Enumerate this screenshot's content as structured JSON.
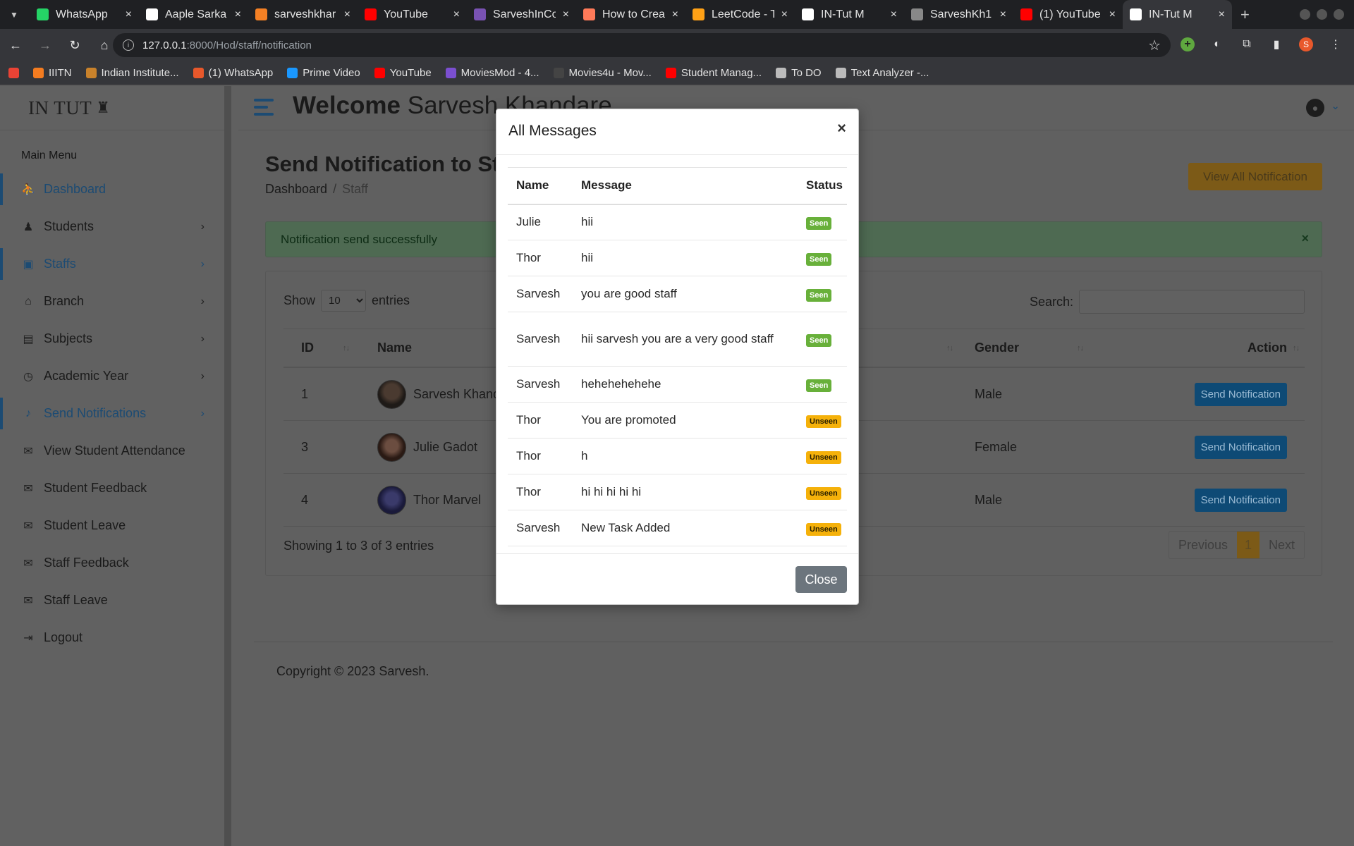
{
  "browser": {
    "tabs": [
      {
        "title": "WhatsApp",
        "icon": "whatsapp-icon",
        "color": "#25d366"
      },
      {
        "title": "Aaple Sarka",
        "icon": "doc-icon",
        "color": "#ffffff"
      },
      {
        "title": "sarveshkhar",
        "icon": "stackoverflow-icon",
        "color": "#f48024"
      },
      {
        "title": "YouTube",
        "icon": "youtube-icon",
        "color": "#ff0000"
      },
      {
        "title": "SarveshInCo",
        "icon": "bootstrap-icon",
        "color": "#7952b3"
      },
      {
        "title": "How to Crea",
        "icon": "hubspot-icon",
        "color": "#ff7a59"
      },
      {
        "title": "LeetCode - T",
        "icon": "leetcode-icon",
        "color": "#ffa116"
      },
      {
        "title": "IN-Tut M",
        "icon": "intut-icon",
        "color": "#ffffff"
      },
      {
        "title": "SarveshKh1",
        "icon": "github-icon",
        "color": "#888888"
      },
      {
        "title": "(1) YouTube",
        "icon": "youtube-icon",
        "color": "#ff0000"
      },
      {
        "title": "IN-Tut M",
        "icon": "intut-icon",
        "color": "#ffffff",
        "active": true
      }
    ],
    "url_host": "127.0.0.1",
    "url_path": ":8000/Hod/staff/notification",
    "bookmarks": [
      {
        "label": "",
        "icon": "gmail-icon",
        "color": "#ea4335"
      },
      {
        "label": "IIITN",
        "icon": "iiitn-icon",
        "color": "#f47c20"
      },
      {
        "label": "Indian Institute...",
        "icon": "institute-icon",
        "color": "#c9822b"
      },
      {
        "label": "(1) WhatsApp",
        "icon": "whatsapp-alert-icon",
        "color": "#e8582b"
      },
      {
        "label": "Prime Video",
        "icon": "prime-video-icon",
        "color": "#1a98ff"
      },
      {
        "label": "YouTube",
        "icon": "youtube-icon",
        "color": "#ff0000"
      },
      {
        "label": "MoviesMod - 4...",
        "icon": "moviesmod-icon",
        "color": "#7b4fd0"
      },
      {
        "label": "Movies4u - Mov...",
        "icon": "movies4u-icon",
        "color": "#444444"
      },
      {
        "label": "Student Manag...",
        "icon": "youtube-icon",
        "color": "#ff0000"
      },
      {
        "label": "To DO",
        "icon": "globe-icon",
        "color": "#bbbbbb"
      },
      {
        "label": "Text Analyzer -...",
        "icon": "gear-icon",
        "color": "#bbbbbb"
      }
    ]
  },
  "app": {
    "logo": "IN TUT",
    "menu_title": "Main Menu",
    "menu": [
      {
        "label": "Dashboard",
        "icon": "dashboard-icon",
        "active": true,
        "chevron": false
      },
      {
        "label": "Students",
        "icon": "students-icon",
        "active": false,
        "chevron": true
      },
      {
        "label": "Staffs",
        "icon": "staffs-icon",
        "active": true,
        "chevron": true
      },
      {
        "label": "Branch",
        "icon": "branch-icon",
        "active": false,
        "chevron": true
      },
      {
        "label": "Subjects",
        "icon": "subjects-icon",
        "active": false,
        "chevron": true
      },
      {
        "label": "Academic Year",
        "icon": "clock-icon",
        "active": false,
        "chevron": true
      },
      {
        "label": "Send Notifications",
        "icon": "bell-icon",
        "active": true,
        "chevron": true
      },
      {
        "label": "View Student Attendance",
        "icon": "chat-icon",
        "active": false,
        "chevron": false
      },
      {
        "label": "Student Feedback",
        "icon": "chat-icon",
        "active": false,
        "chevron": false
      },
      {
        "label": "Student Leave",
        "icon": "chat-icon",
        "active": false,
        "chevron": false
      },
      {
        "label": "Staff Feedback",
        "icon": "chat-icon",
        "active": false,
        "chevron": false
      },
      {
        "label": "Staff Leave",
        "icon": "chat-icon",
        "active": false,
        "chevron": false
      },
      {
        "label": "Logout",
        "icon": "logout-icon",
        "active": false,
        "chevron": false
      }
    ],
    "welcome_bold": "Welcome",
    "welcome_name": "Sarvesh Khandare",
    "page_title": "Send Notification to St",
    "breadcrumb": {
      "home": "Dashboard",
      "current": "Staff"
    },
    "view_all_label": "View All Notification",
    "alert_text": "Notification send successfully",
    "show_label": "Show",
    "entries_value": "10",
    "entries_label": "entries",
    "search_label": "Search:",
    "table": {
      "headers": {
        "id": "ID",
        "name": "Name",
        "gender": "Gender",
        "action": "Action"
      },
      "rows": [
        {
          "id": "1",
          "name": "Sarvesh Khand",
          "gender": "Male",
          "action": "Send Notification"
        },
        {
          "id": "3",
          "name": "Julie Gadot",
          "gender": "Female",
          "action": "Send Notification"
        },
        {
          "id": "4",
          "name": "Thor Marvel",
          "gender": "Male",
          "action": "Send Notification"
        }
      ]
    },
    "showing_text": "Showing 1 to 3 of 3 entries",
    "pager": {
      "previous": "Previous",
      "page": "1",
      "next": "Next"
    },
    "copyright": "Copyright © 2023 Sarvesh."
  },
  "modal": {
    "title": "All Messages",
    "close_x": "×",
    "headers": {
      "name": "Name",
      "message": "Message",
      "status": "Status"
    },
    "messages": [
      {
        "name": "Julie",
        "message": "hii",
        "status": "Seen"
      },
      {
        "name": "Thor",
        "message": "hii",
        "status": "Seen"
      },
      {
        "name": "Sarvesh",
        "message": "you are good staff",
        "status": "Seen"
      },
      {
        "name": "Sarvesh",
        "message": "hii sarvesh you are a very good staff",
        "status": "Seen"
      },
      {
        "name": "Sarvesh",
        "message": "hehehehehehe",
        "status": "Seen"
      },
      {
        "name": "Thor",
        "message": "You are promoted",
        "status": "Unseen"
      },
      {
        "name": "Thor",
        "message": "h",
        "status": "Unseen"
      },
      {
        "name": "Thor",
        "message": "hi hi hi hi hi",
        "status": "Unseen"
      },
      {
        "name": "Sarvesh",
        "message": "New Task Added",
        "status": "Unseen"
      }
    ],
    "close_label": "Close"
  }
}
